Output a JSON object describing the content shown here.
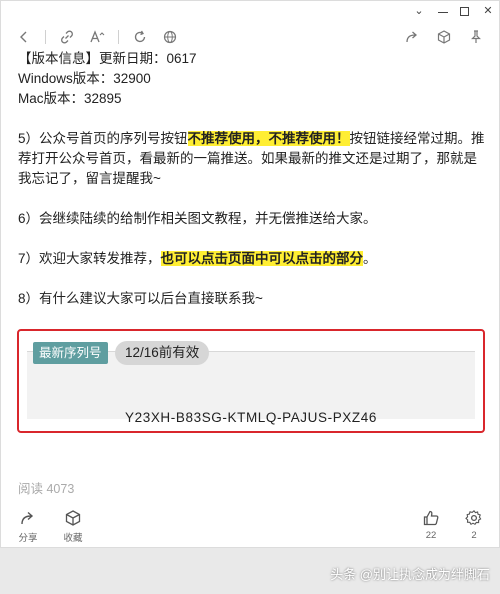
{
  "window_controls": {
    "dropdown": "⌄"
  },
  "content": {
    "version_info": "【版本信息】更新日期：0617",
    "windows_version": "Windows版本：32900",
    "mac_version": "Mac版本：32895",
    "p5_a": "5）公众号首页的序列号按钮",
    "p5_highlight": "不推荐使用，不推荐使用！",
    "p5_b": "按钮链接经常过期。推荐打开公众号首页，看最新的一篇推送。如果最新的推文还是过期了，那就是我忘记了，留言提醒我~",
    "p6": "6）会继续陆续的给制作相关图文教程，并无偿推送给大家。",
    "p7_a": "7）欢迎大家转发推荐，",
    "p7_highlight": "也可以点击页面中可以点击的部分",
    "p7_b": "。",
    "p8": "8）有什么建议大家可以后台直接联系我~"
  },
  "card": {
    "tag": "最新序列号",
    "date_badge": "12/16前有效",
    "serial": "Y23XH-B83SG-KTMLQ-PAJUS-PXZ46"
  },
  "reads": "阅读 4073",
  "actions": {
    "share_label": "分享",
    "collect_label": "收藏",
    "like_count": "22",
    "comment_count": "2"
  },
  "watermark": "头条 @别让执念成为绊脚石",
  "colors": {
    "highlight": "#ffee33",
    "card_border": "#d9262c",
    "tag_bg": "#5f9ea0"
  }
}
